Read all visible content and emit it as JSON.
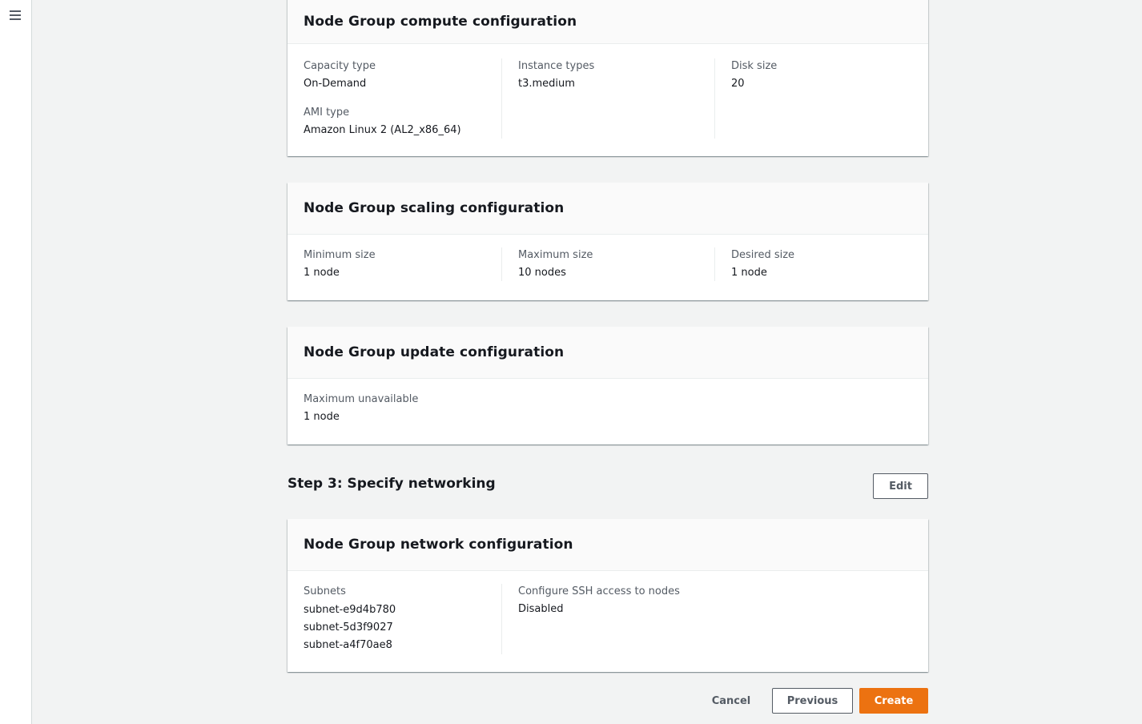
{
  "sidebar": {
    "menu_icon": "hamburger-menu-icon"
  },
  "compute": {
    "title": "Node Group compute configuration",
    "capacity_type_label": "Capacity type",
    "capacity_type_value": "On-Demand",
    "ami_type_label": "AMI type",
    "ami_type_value": "Amazon Linux 2 (AL2_x86_64)",
    "instance_types_label": "Instance types",
    "instance_types_value": "t3.medium",
    "disk_size_label": "Disk size",
    "disk_size_value": "20"
  },
  "scaling": {
    "title": "Node Group scaling configuration",
    "min_label": "Minimum size",
    "min_value": "1 node",
    "max_label": "Maximum size",
    "max_value": "10 nodes",
    "desired_label": "Desired size",
    "desired_value": "1 node"
  },
  "update": {
    "title": "Node Group update configuration",
    "max_unavailable_label": "Maximum unavailable",
    "max_unavailable_value": "1 node"
  },
  "step3": {
    "title": "Step 3: Specify networking",
    "edit_label": "Edit"
  },
  "network": {
    "title": "Node Group network configuration",
    "subnets_label": "Subnets",
    "subnets": [
      "subnet-e9d4b780",
      "subnet-5d3f9027",
      "subnet-a4f70ae8"
    ],
    "ssh_label": "Configure SSH access to nodes",
    "ssh_value": "Disabled"
  },
  "footer": {
    "cancel_label": "Cancel",
    "previous_label": "Previous",
    "create_label": "Create"
  },
  "colors": {
    "primary": "#ec7211",
    "background": "#f2f3f3",
    "text": "#16191f",
    "label": "#545b64"
  }
}
